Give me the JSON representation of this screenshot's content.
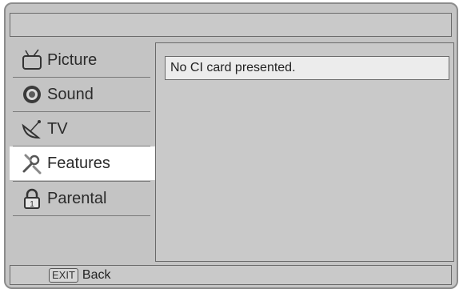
{
  "header": {
    "title": ""
  },
  "sidebar": {
    "items": [
      {
        "label": "Picture",
        "icon": "tv-icon",
        "selected": false
      },
      {
        "label": "Sound",
        "icon": "speaker-icon",
        "selected": false
      },
      {
        "label": "TV",
        "icon": "satellite-dish-icon",
        "selected": false
      },
      {
        "label": "Features",
        "icon": "tools-icon",
        "selected": true
      },
      {
        "label": "Parental",
        "icon": "padlock-icon",
        "selected": false
      }
    ]
  },
  "content": {
    "message": "No CI card presented."
  },
  "footer": {
    "key": "EXIT",
    "label": "Back"
  }
}
